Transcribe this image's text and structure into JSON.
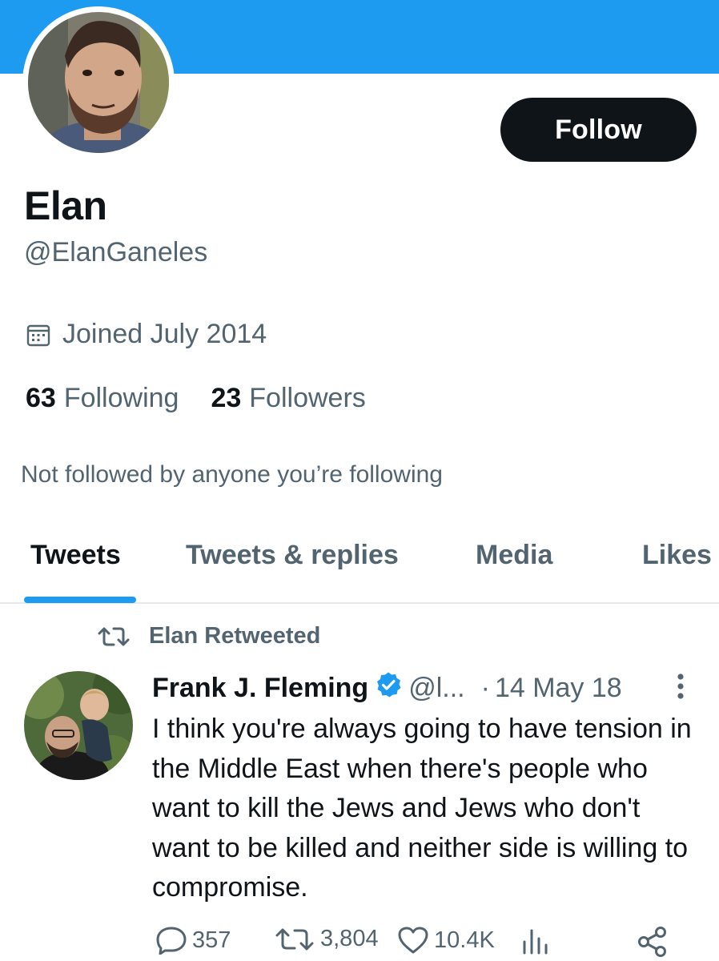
{
  "colors": {
    "banner": "#1d9bf0",
    "accent": "#1d9bf0",
    "text_primary": "#0f1419",
    "text_secondary": "#536471",
    "button_bg": "#0f1419"
  },
  "profile": {
    "avatar_icon": "profile-photo",
    "follow_label": "Follow",
    "display_name": "Elan",
    "handle": "@ElanGaneles",
    "joined_icon": "calendar-icon",
    "joined": "Joined July 2014",
    "following_count": "63",
    "following_label": "Following",
    "followers_count": "23",
    "followers_label": "Followers",
    "not_followed": "Not followed by anyone you’re following"
  },
  "tabs": [
    {
      "label": "Tweets",
      "active": true
    },
    {
      "label": "Tweets & replies",
      "active": false
    },
    {
      "label": "Media",
      "active": false
    },
    {
      "label": "Likes",
      "active": false
    }
  ],
  "tweet": {
    "retweet_icon": "retweet-icon",
    "retweeted_by": "Elan Retweeted",
    "author_name": "Frank J. Fleming",
    "verified_icon": "verified-badge-icon",
    "author_handle": "@l...",
    "separator": "·",
    "date": "14 May 18",
    "text": "I think you're always going to have tension in the Middle East when there's people who want to kill the Jews and Jews who don't want to be killed and neither side is willing to compromise.",
    "replies": "357",
    "retweets": "3,804",
    "likes": "10.4K"
  }
}
